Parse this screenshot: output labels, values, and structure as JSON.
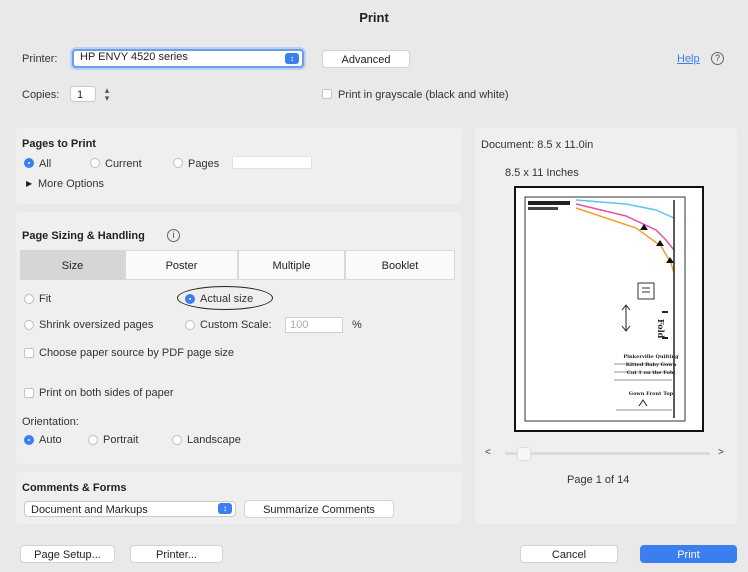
{
  "window": {
    "title": "Print"
  },
  "printer": {
    "label": "Printer:",
    "value": "HP ENVY 4520 series",
    "advanced": "Advanced",
    "help": "Help",
    "help_icon": "?"
  },
  "copies": {
    "label": "Copies:",
    "value": "1",
    "grayscale": "Print in grayscale (black and white)"
  },
  "pages_to_print": {
    "heading": "Pages to Print",
    "all": "All",
    "current": "Current",
    "pages": "Pages",
    "more_options": "More Options",
    "selected": "All"
  },
  "page_sizing": {
    "heading": "Page Sizing & Handling",
    "info_icon": "i",
    "tabs": [
      "Size",
      "Poster",
      "Multiple",
      "Booklet"
    ],
    "active_tab": "Size",
    "fit": "Fit",
    "actual_size": "Actual size",
    "shrink": "Shrink oversized pages",
    "custom_scale": "Custom Scale:",
    "custom_scale_value": "100",
    "percent": "%",
    "choose_paper": "Choose paper source by PDF page size",
    "both_sides": "Print on both sides of paper",
    "orientation_label": "Orientation:",
    "auto": "Auto",
    "portrait": "Portrait",
    "landscape": "Landscape"
  },
  "comments": {
    "heading": "Comments & Forms",
    "value": "Document and Markups",
    "summarize": "Summarize Comments"
  },
  "preview": {
    "document": "Document: 8.5 x 11.0in",
    "paper": "8.5 x 11 Inches",
    "page_status": "Page 1 of 14",
    "prev": "<",
    "next": ">",
    "artwork_text": {
      "line1": "Pinkerville Quilting",
      "line2": "Kitted Baby Gown",
      "line3": "Cut 1 on the Fold",
      "line4": "Gown Front Top",
      "fold": "Fold"
    }
  },
  "footer": {
    "page_setup": "Page Setup...",
    "printer": "Printer...",
    "cancel": "Cancel",
    "print": "Print"
  },
  "colors": {
    "accent": "#3a7ef0",
    "background": "#e9e9e9"
  }
}
